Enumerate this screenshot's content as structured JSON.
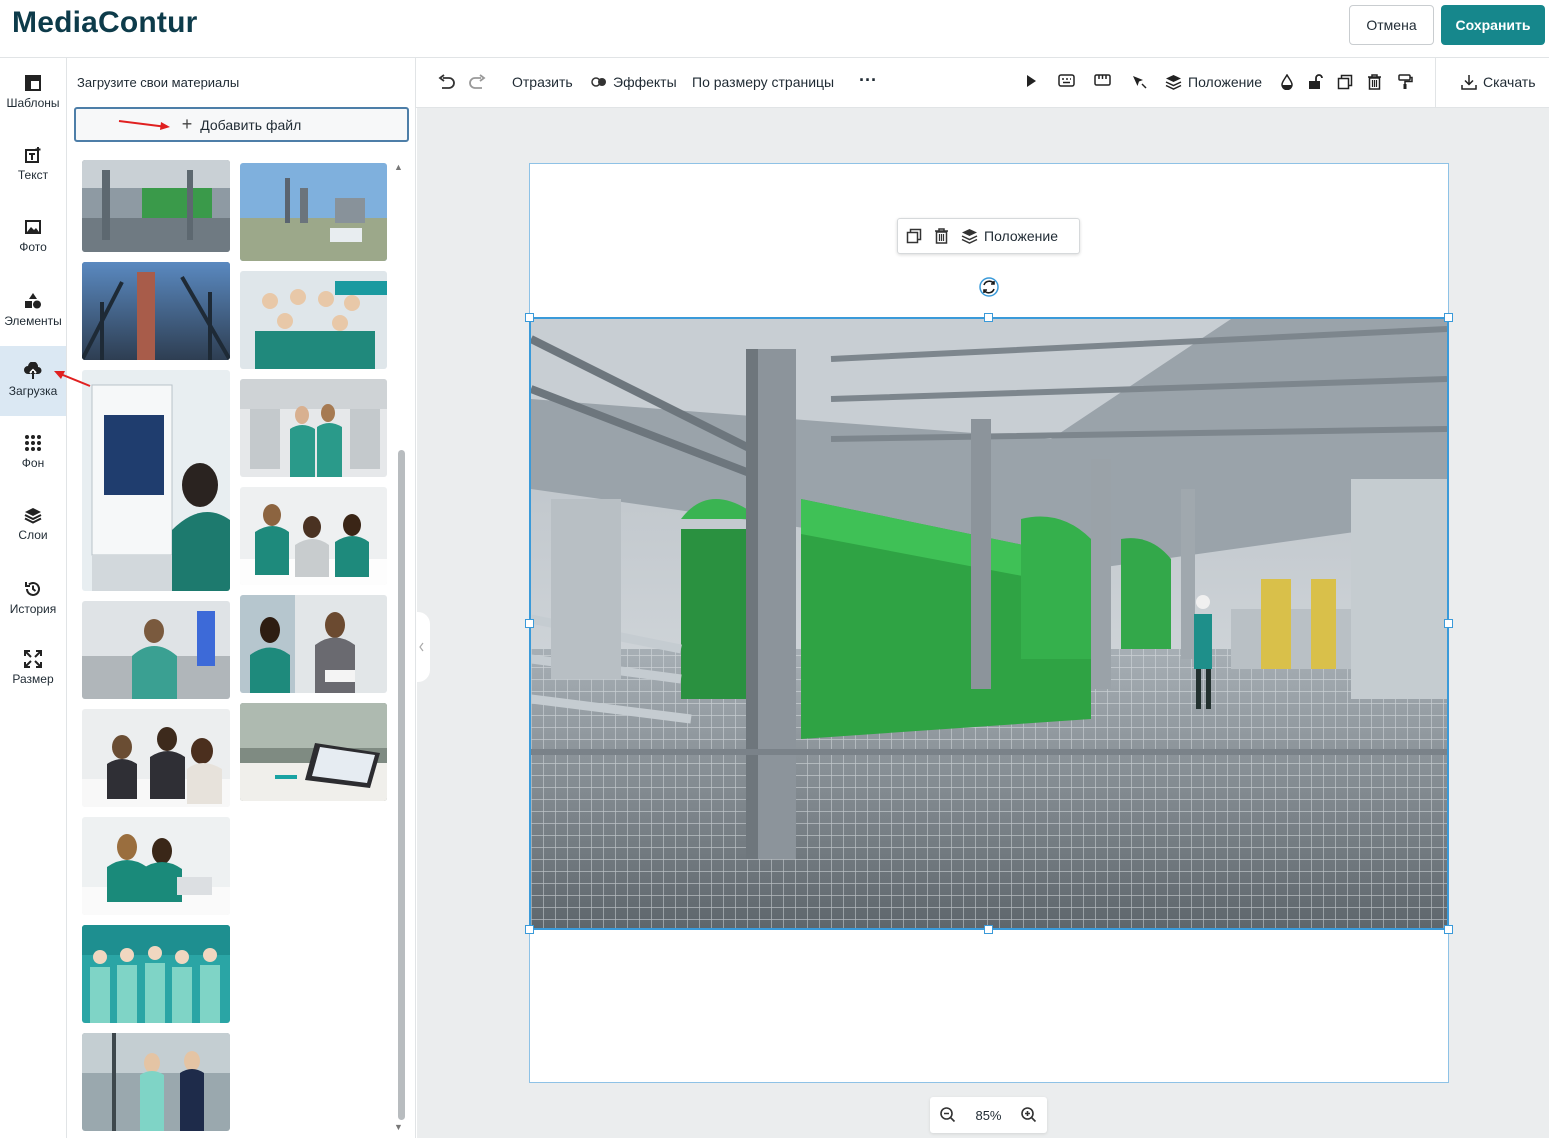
{
  "header": {
    "logo": "MediaContur",
    "cancel_label": "Отмена",
    "save_label": "Сохранить"
  },
  "rail": {
    "items": [
      {
        "label": "Шаблоны",
        "icon": "templates-icon"
      },
      {
        "label": "Текст",
        "icon": "text-icon"
      },
      {
        "label": "Фото",
        "icon": "photo-icon"
      },
      {
        "label": "Элементы",
        "icon": "elements-icon"
      },
      {
        "label": "Загрузка",
        "icon": "upload-icon",
        "active": true
      },
      {
        "label": "Фон",
        "icon": "background-icon"
      },
      {
        "label": "Слои",
        "icon": "layers-icon"
      },
      {
        "label": "История",
        "icon": "history-icon"
      },
      {
        "label": "Размер",
        "icon": "resize-icon"
      }
    ]
  },
  "panel": {
    "title": "Загрузите свои материалы",
    "add_file_label": "Добавить файл",
    "thumbnails": [
      {
        "name": "factory-hall"
      },
      {
        "name": "refinery-exterior"
      },
      {
        "name": "steel-tower"
      },
      {
        "name": "team-group-photo"
      },
      {
        "name": "lab-equipment"
      },
      {
        "name": "lab-workers"
      },
      {
        "name": "office-team"
      },
      {
        "name": "lab-analyzer"
      },
      {
        "name": "office-meeting"
      },
      {
        "name": "team-laptop"
      },
      {
        "name": "laptop-desk"
      },
      {
        "name": "team-at-table"
      },
      {
        "name": "team-brand-wall"
      },
      {
        "name": "factory-handshake"
      }
    ]
  },
  "toolbar": {
    "flip_label": "Отразить",
    "effects_label": "Эффекты",
    "fit_page_label": "По размеру страницы",
    "position_label": "Положение",
    "download_label": "Скачать"
  },
  "canvas": {
    "float_position_label": "Положение",
    "zoom_level": "85%"
  },
  "colors": {
    "brand_teal": "#16878c",
    "logo_dark": "#0d3b4a",
    "selection_blue": "#3a9ad9",
    "active_rail": "#dbe8f3",
    "annotation_red": "#e02020",
    "machinery_green": "#2fa344"
  }
}
